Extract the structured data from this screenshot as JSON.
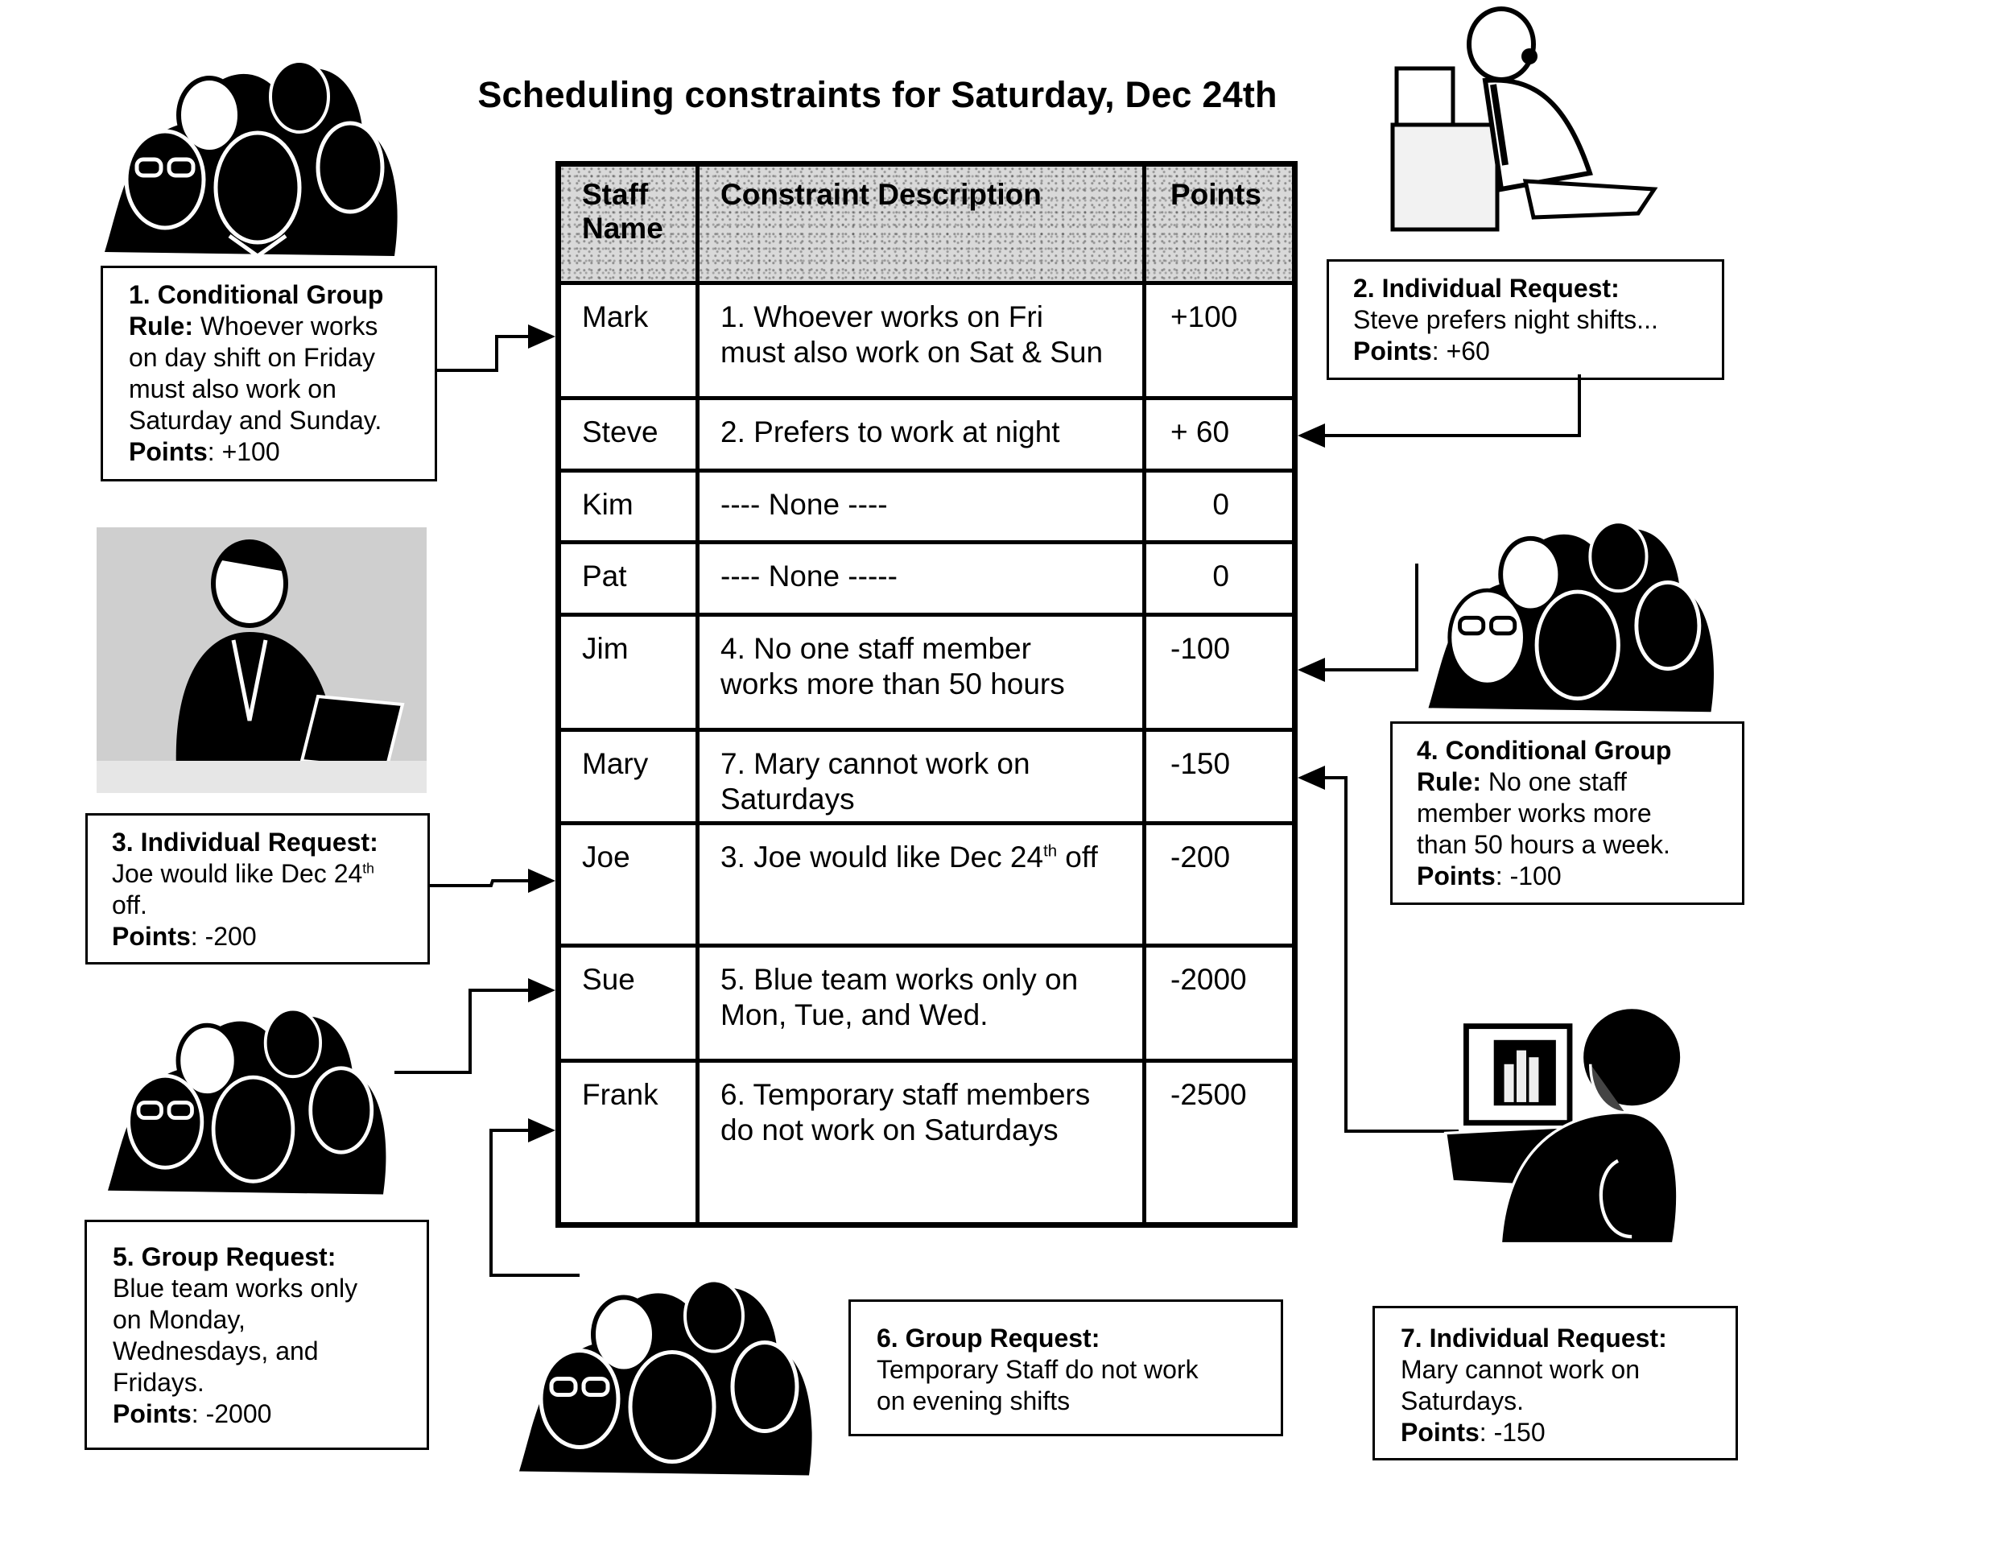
{
  "title": "Scheduling constraints for Saturday, Dec 24th",
  "table": {
    "headers": {
      "staff_line1": "Staff",
      "staff_line2": "Name",
      "description": "Constraint Description",
      "points": "Points"
    },
    "rows": [
      {
        "staff": "Mark",
        "desc1": "1. Whoever works on Fri",
        "desc2": "must also work on Sat & Sun",
        "points": "+100"
      },
      {
        "staff": "Steve",
        "desc1": "2. Prefers to work at night",
        "desc2": "",
        "points": "+ 60"
      },
      {
        "staff": "Kim",
        "desc1": "---- None ----",
        "desc2": "",
        "points": "0"
      },
      {
        "staff": "Pat",
        "desc1": "---- None -----",
        "desc2": "",
        "points": "0"
      },
      {
        "staff": "Jim",
        "desc1": "4. No one staff member",
        "desc2": "works more than 50 hours",
        "points": "-100"
      },
      {
        "staff": "Mary",
        "desc1": "7. Mary cannot work on",
        "desc2": "Saturdays",
        "points": "-150"
      },
      {
        "staff": "Joe",
        "desc1a": "3. Joe would like Dec 24",
        "desc1sup": "th",
        "desc1b": " off",
        "desc2": "",
        "points": "-200"
      },
      {
        "staff": "Sue",
        "desc1": "5. Blue team works only on",
        "desc2": "Mon, Tue, and Wed.",
        "points": "-2000"
      },
      {
        "staff": "Frank",
        "desc1": "6. Temporary staff members",
        "desc2": "do not work on Saturdays",
        "points": "-2500"
      }
    ]
  },
  "callouts": {
    "c1": {
      "heading": "1. Conditional Group",
      "rule_label": "Rule:",
      "line2": "  Whoever works",
      "line3": "on day shift on Friday",
      "line4": "must also work on",
      "line5": "Saturday and Sunday.",
      "points_label": "Points",
      "points_value": ": +100"
    },
    "c2": {
      "heading": "2. Individual Request:",
      "line2": "Steve prefers night shifts...",
      "points_label": "Points",
      "points_value": ": +60"
    },
    "c3": {
      "heading": "3. Individual Request:",
      "line2a": "Joe would like Dec 24",
      "line2sup": "th",
      "line3": "off.",
      "points_label": "Points",
      "points_value": ": -200"
    },
    "c4": {
      "heading": "4. Conditional Group",
      "rule_label": "Rule:",
      "line2": "  No one staff",
      "line3": "member works more",
      "line4": "than 50 hours a week.",
      "points_label": "Points",
      "points_value": ": -100"
    },
    "c5": {
      "heading": "5. Group Request:",
      "line2": "Blue team works only",
      "line3": "on Monday,",
      "line4": "Wednesdays, and",
      "line5": "Fridays.",
      "points_label": "Points",
      "points_value": ": -2000"
    },
    "c6": {
      "heading": "6. Group Request:",
      "line2": "Temporary Staff do not work",
      "line3": "on evening shifts"
    },
    "c7": {
      "heading": "7. Individual Request:",
      "line2": "Mary cannot work on",
      "line3": "Saturdays.",
      "points_label": "Points",
      "points_value": ": -150"
    }
  },
  "clipart": {
    "group_icon": "group-of-people-icon",
    "call_center_icon": "headset-operator-icon",
    "laptop_worker_icon": "man-with-laptop-icon",
    "computer_woman_icon": "woman-at-computer-icon"
  }
}
